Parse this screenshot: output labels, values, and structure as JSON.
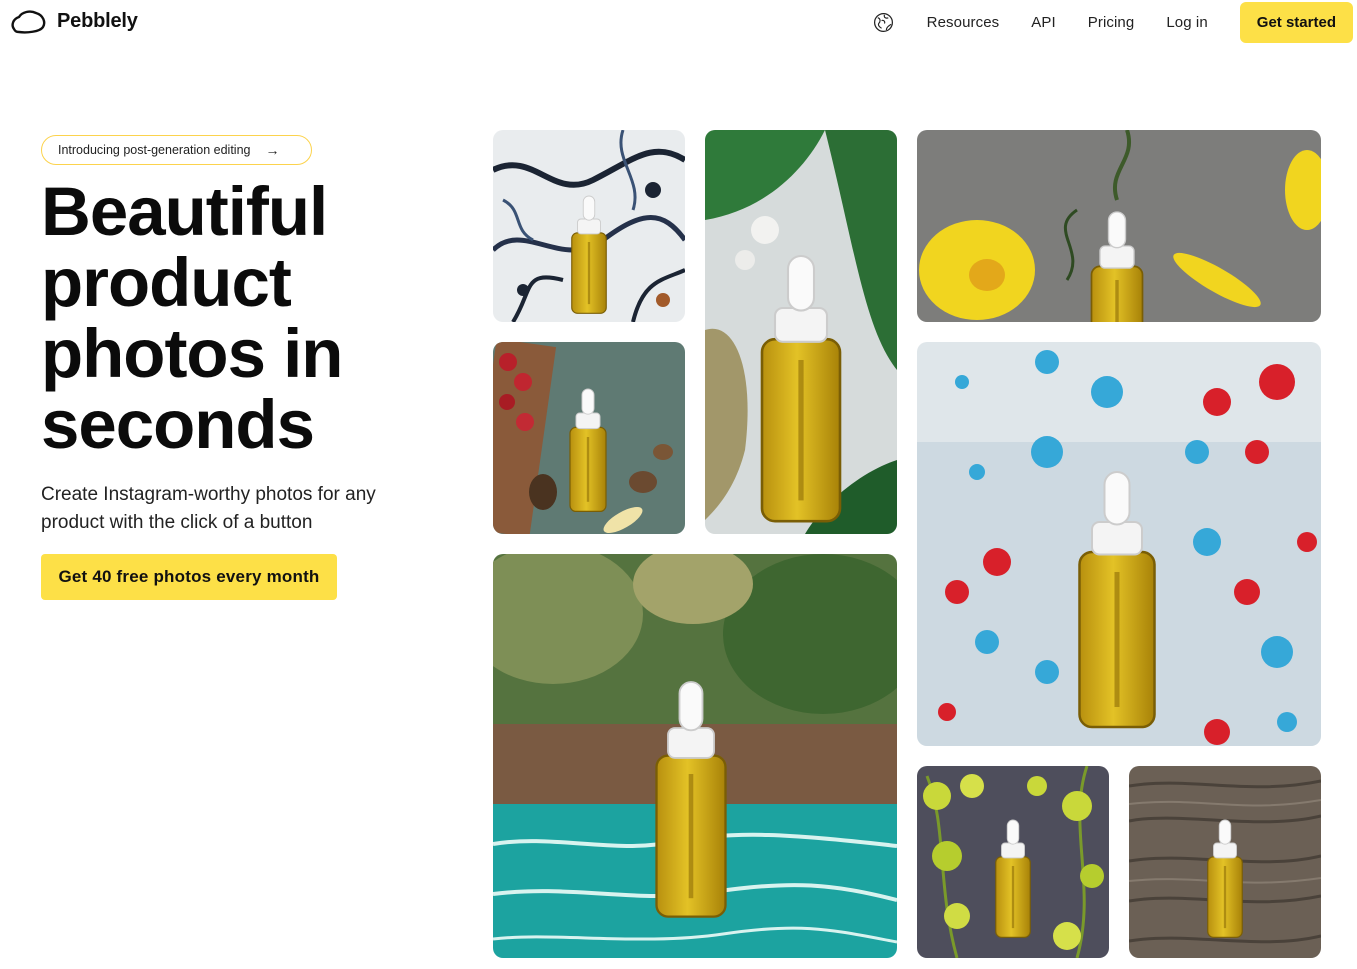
{
  "brand": {
    "name": "Pebblely",
    "logo_icon": "cloud-pebble-icon"
  },
  "nav": {
    "language_icon": "globe-icon",
    "links": [
      "Resources",
      "API",
      "Pricing",
      "Log in"
    ],
    "cta": "Get started"
  },
  "hero": {
    "announcement": "Introducing post-generation editing",
    "announcement_arrow": "→",
    "headline": "Beautiful product photos in seconds",
    "subtitle": "Create Instagram-worthy photos for any product with the click of a button",
    "button": "Get 40 free photos every month"
  },
  "gallery": {
    "product": "serum dropper bottle",
    "scenes": [
      "marble stone",
      "monstera leaves on water",
      "yellow flowers on concrete",
      "fruits and nuts",
      "paint splatter",
      "jungle pool",
      "vine leaves",
      "wood bark"
    ]
  },
  "colors": {
    "accent": "#fde047",
    "pill_border": "#fcd34d",
    "text": "#111111"
  }
}
